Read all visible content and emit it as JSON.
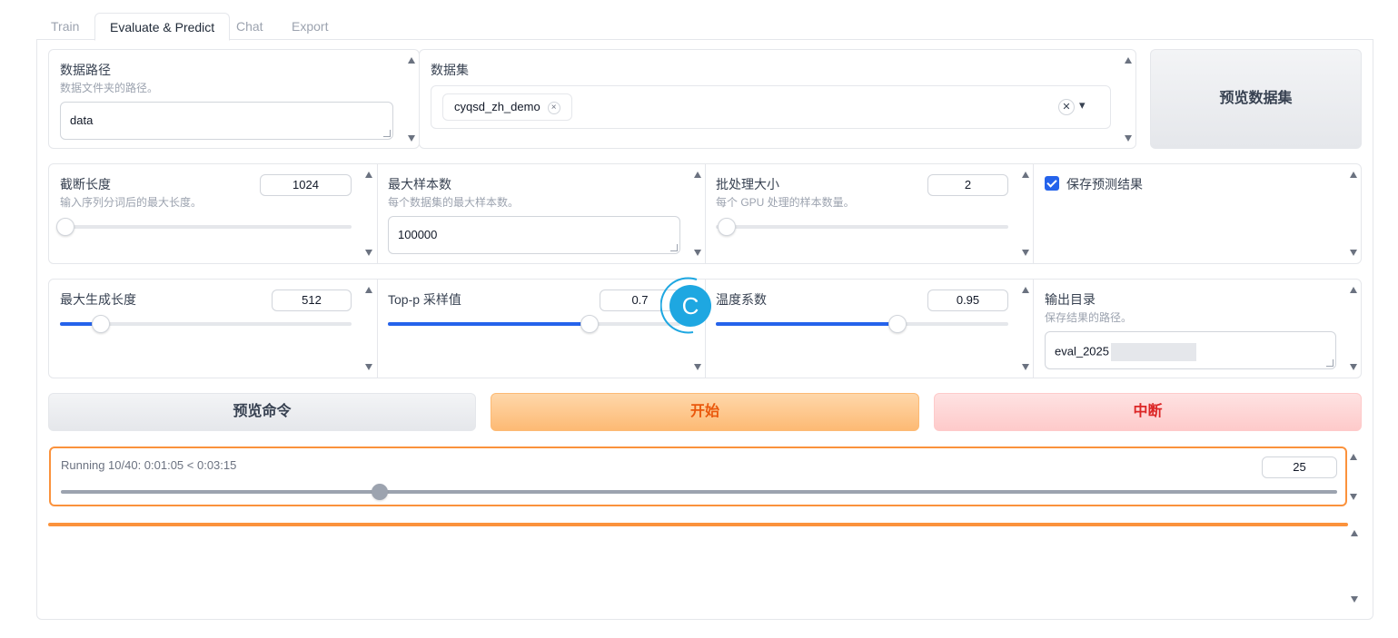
{
  "tabs": [
    {
      "label": "Train",
      "active": false
    },
    {
      "label": "Evaluate & Predict",
      "active": true
    },
    {
      "label": "Chat",
      "active": false
    },
    {
      "label": "Export",
      "active": false
    }
  ],
  "dataset_dir": {
    "label": "数据路径",
    "info": "数据文件夹的路径。",
    "value": "data"
  },
  "dataset": {
    "label": "数据集",
    "selected": [
      "cyqsd_zh_demo"
    ],
    "chip_remove": "×",
    "clear": "✕",
    "dropdown": "▾"
  },
  "preview_dataset_button": "预览数据集",
  "cutoff_len": {
    "label": "截断长度",
    "info": "输入序列分词后的最大长度。",
    "value": "1024",
    "fraction": 0.02
  },
  "max_samples": {
    "label": "最大样本数",
    "info": "每个数据集的最大样本数。",
    "value": "100000"
  },
  "batch_size": {
    "label": "批处理大小",
    "info": "每个 GPU 处理的样本数量。",
    "value": "2",
    "fraction": 0.0
  },
  "predict": {
    "label": "保存预测结果",
    "checked": true
  },
  "max_new_tokens": {
    "label": "最大生成长度",
    "value": "512",
    "fraction": 0.14
  },
  "top_p": {
    "label": "Top-p 采样值",
    "value": "0.7",
    "fraction": 0.69
  },
  "spinner_glyph": "C",
  "temperature": {
    "label": "温度系数",
    "value": "0.95",
    "fraction": 0.62
  },
  "output_dir": {
    "label": "输出目录",
    "info": "保存结果的路径。",
    "value": "eval_2025"
  },
  "buttons": {
    "preview_command": "预览命令",
    "start": "开始",
    "stop": "中断"
  },
  "progress": {
    "label": "Running 10/40: 0:01:05 < 0:03:15",
    "value": "25",
    "fraction": 0.25
  },
  "colors": {
    "accent": "#2563eb",
    "primary": "#f97316",
    "stop": "#dc2626",
    "progress_border": "#fb923c",
    "spinner": "#1ea7e1"
  }
}
